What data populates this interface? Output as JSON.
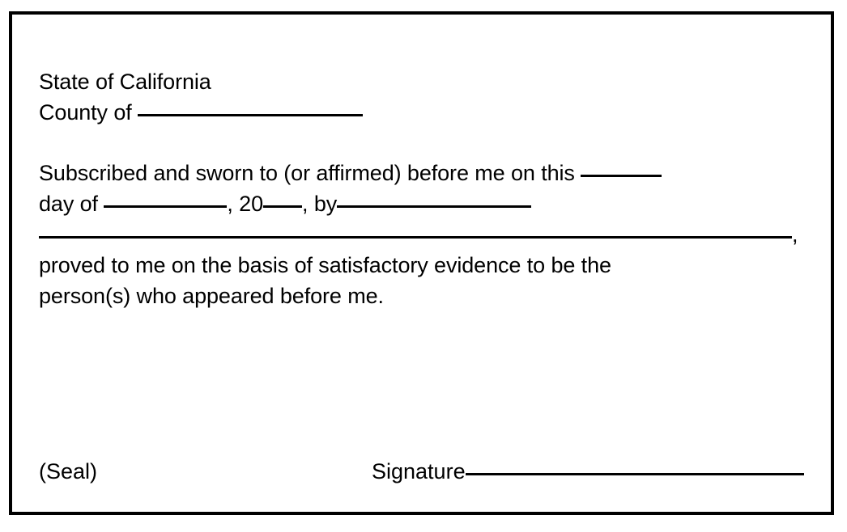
{
  "document": {
    "type": "notary-acknowledgment-block",
    "state_line": "State of California",
    "county_label": "County of",
    "sworn": {
      "intro": "Subscribed and sworn to (or affirmed) before me on this",
      "day_label": "day of",
      "comma_after_day": ",",
      "year_prefix": "20",
      "comma_after_year": ",",
      "by_label": "by",
      "comma_after_name": ",",
      "proved_line": "proved to me on the basis of satisfactory evidence to be the",
      "person_line": "person(s) who appeared before me."
    },
    "footer": {
      "seal_label": "(Seal)",
      "signature_label": "Signature"
    },
    "fill_in_values": {
      "county": "",
      "this_day": "",
      "month": "",
      "year_suffix": "",
      "name_part1": "",
      "name_part2": "",
      "signature": ""
    },
    "colors": {
      "border": "#000000",
      "text": "#000000",
      "background": "#ffffff",
      "rule": "#000000"
    }
  }
}
